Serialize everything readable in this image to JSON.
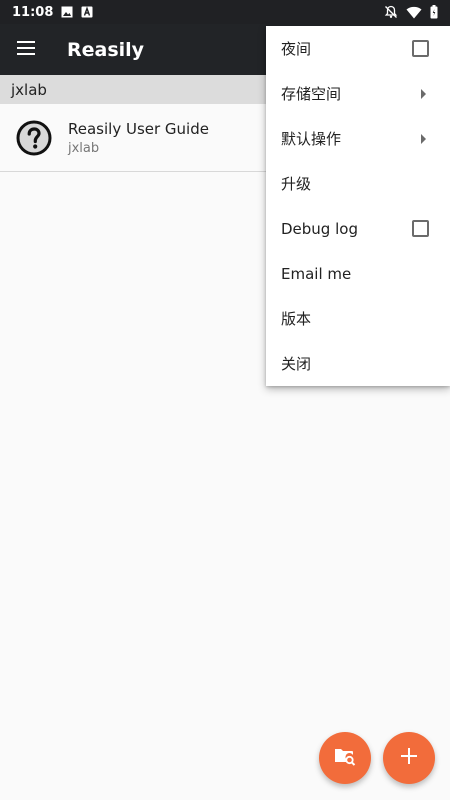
{
  "status_bar": {
    "time": "11:08",
    "left_icons": [
      "image-icon",
      "a-icon"
    ],
    "right_icons": [
      "notifications-off-icon",
      "wifi-icon",
      "battery-icon"
    ]
  },
  "app_bar": {
    "title": "Reasily",
    "nav_icon": "hamburger-menu-icon"
  },
  "section_header": "jxlab",
  "list": [
    {
      "title": "Reasily User Guide",
      "subtitle": "jxlab",
      "icon": "help-circle-icon"
    }
  ],
  "menu": {
    "items": [
      {
        "label": "夜间",
        "trailing": "checkbox",
        "checked": false
      },
      {
        "label": "存储空间",
        "trailing": "submenu-arrow"
      },
      {
        "label": "默认操作",
        "trailing": "submenu-arrow"
      },
      {
        "label": "升级",
        "trailing": ""
      },
      {
        "label": "Debug log",
        "trailing": "checkbox",
        "checked": false
      },
      {
        "label": "Email me",
        "trailing": ""
      },
      {
        "label": "版本",
        "trailing": ""
      },
      {
        "label": "关闭",
        "trailing": ""
      }
    ]
  },
  "fabs": [
    {
      "icon": "folder-search-icon"
    },
    {
      "icon": "plus-icon"
    }
  ],
  "colors": {
    "app_bar": "#222427",
    "status_bar": "#202124",
    "fab": "#f26c3b",
    "section_header": "#dcdcdc",
    "background": "#fafafa"
  }
}
